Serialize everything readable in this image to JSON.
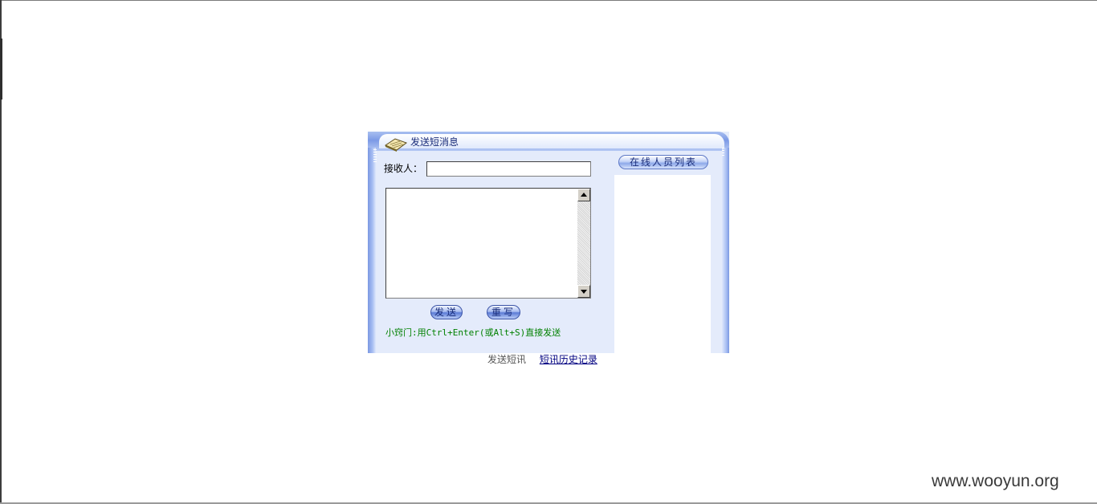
{
  "panel": {
    "title": "发送短消息"
  },
  "form": {
    "recipient_label": "接收人：",
    "recipient_value": "",
    "message_value": "",
    "send_label": "发送",
    "reset_label": "重写",
    "tip": "小窍门:用Ctrl+Enter(或Alt+S)直接发送"
  },
  "online": {
    "header": "在线人员列表"
  },
  "footer": {
    "current_tab": "发送短讯",
    "history_link": "短讯历史记录"
  },
  "watermark": "www.wooyun.org",
  "colors": {
    "panel_bg": "#e4ebfb",
    "header_blue": "#7c9ae6",
    "tip_green": "#008000",
    "link_navy": "#000080"
  },
  "icons": {
    "header": "book-icon",
    "scroll_up": "scroll-up-arrow-icon",
    "scroll_down": "scroll-down-arrow-icon"
  }
}
